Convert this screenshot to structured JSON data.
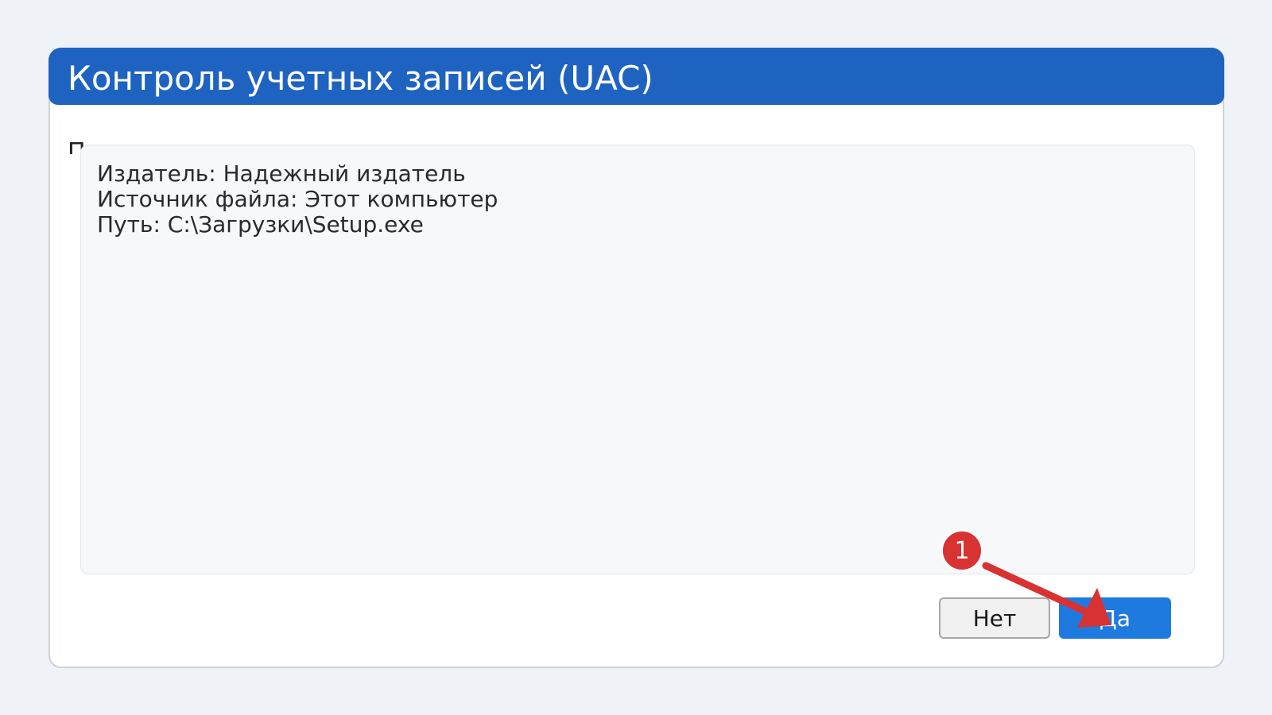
{
  "dialog": {
    "title": "Контроль учетных записей (UAC)",
    "partial_prompt": "П"
  },
  "details": {
    "publisher": "Издатель: Надежный издатель",
    "source": "Источник файла: Этот компьютер",
    "path": "Путь: C:\\Загрузки\\Setup.exe"
  },
  "buttons": {
    "no": "Нет",
    "yes": "Да"
  },
  "annotation": {
    "step": "1",
    "color": "#d93232"
  }
}
